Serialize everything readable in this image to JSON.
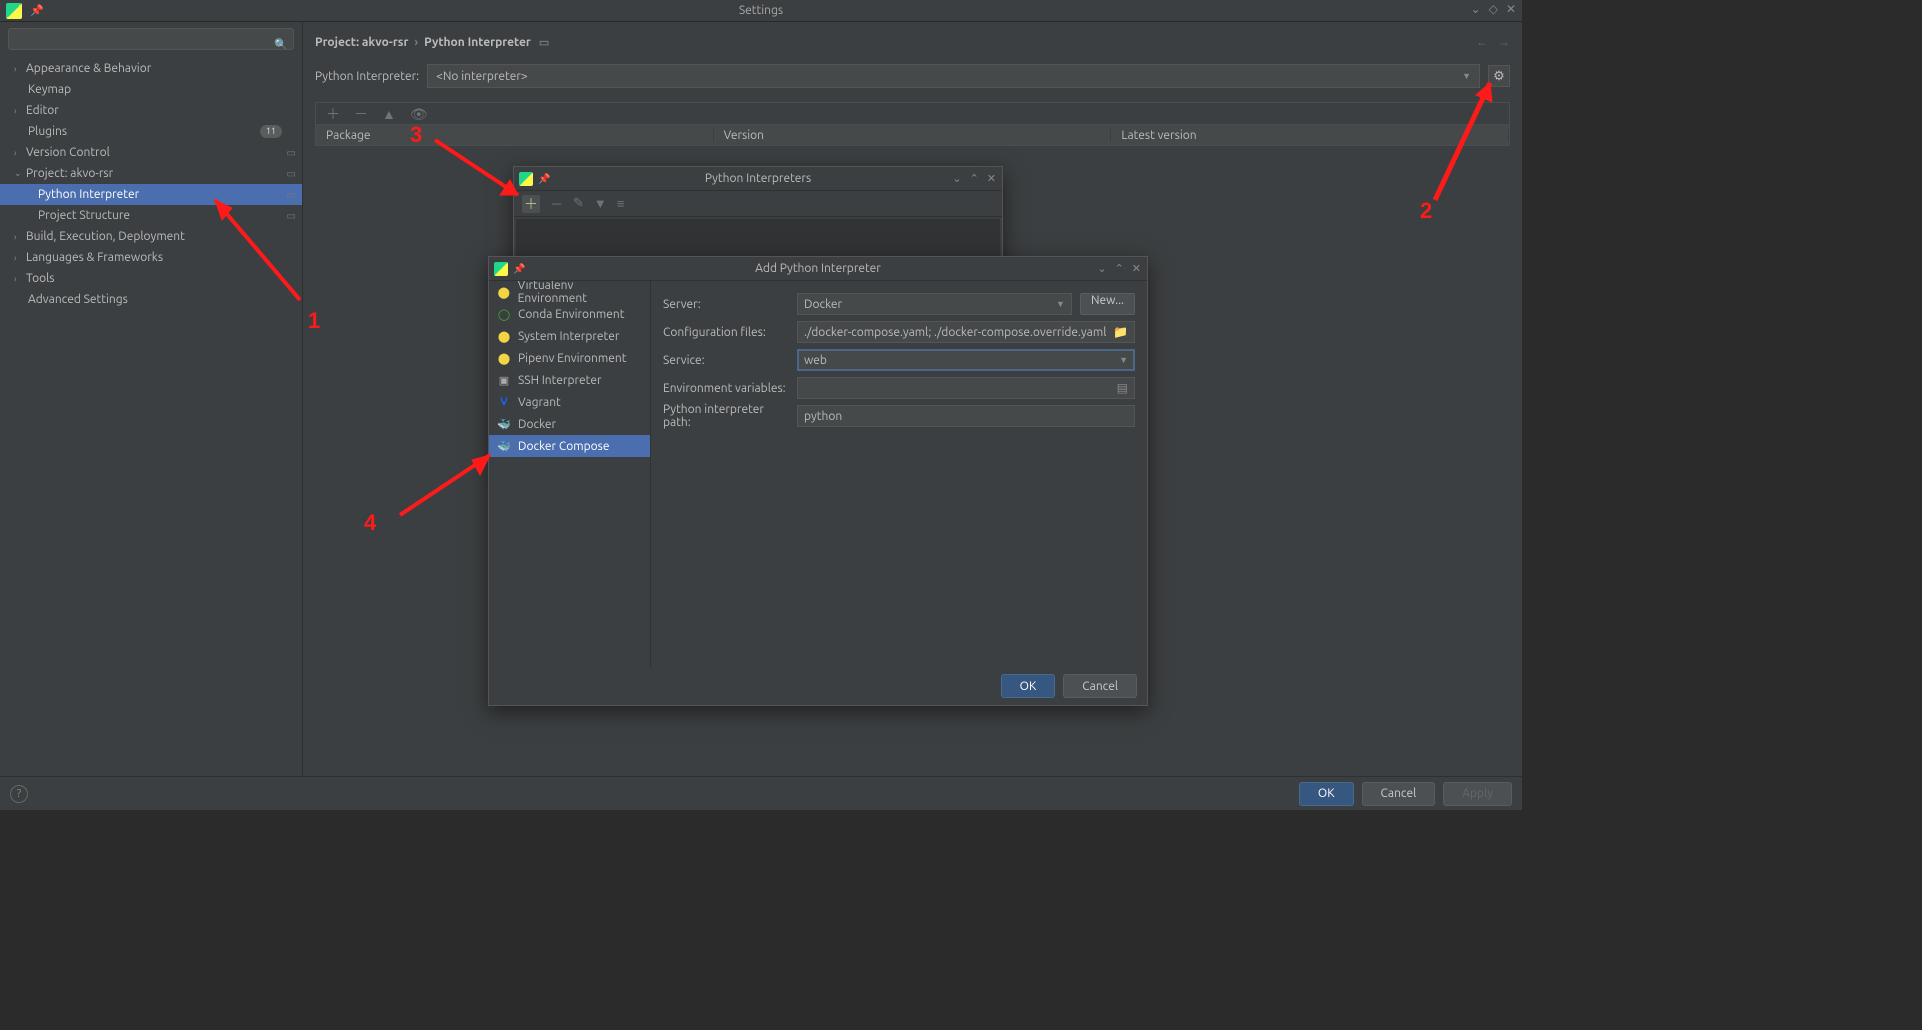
{
  "window": {
    "title": "Settings"
  },
  "sidebar": {
    "search_placeholder": "",
    "items": [
      {
        "label": "Appearance & Behavior",
        "expandable": true
      },
      {
        "label": "Keymap"
      },
      {
        "label": "Editor",
        "expandable": true
      },
      {
        "label": "Plugins",
        "badge": "11"
      },
      {
        "label": "Version Control",
        "expandable": true,
        "perproj": true
      },
      {
        "label": "Project: akvo-rsr",
        "expandable": true,
        "expanded": true,
        "perproj": true,
        "children": [
          {
            "label": "Python Interpreter",
            "perproj": true,
            "selected": true
          },
          {
            "label": "Project Structure",
            "perproj": true
          }
        ]
      },
      {
        "label": "Build, Execution, Deployment",
        "expandable": true
      },
      {
        "label": "Languages & Frameworks",
        "expandable": true
      },
      {
        "label": "Tools",
        "expandable": true
      },
      {
        "label": "Advanced Settings"
      }
    ]
  },
  "crumbs": {
    "a": "Project: akvo-rsr",
    "b": "Python Interpreter"
  },
  "interpreter_row": {
    "label": "Python Interpreter:",
    "value": "<No interpreter>"
  },
  "pkg_columns": {
    "a": "Package",
    "b": "Version",
    "c": "Latest version"
  },
  "dlg1": {
    "title": "Python Interpreters"
  },
  "dlg2": {
    "title": "Add Python Interpreter",
    "types": [
      "Virtualenv Environment",
      "Conda Environment",
      "System Interpreter",
      "Pipenv Environment",
      "SSH Interpreter",
      "Vagrant",
      "Docker",
      "Docker Compose"
    ],
    "fields": {
      "server_label": "Server:",
      "server_value": "Docker",
      "new_label": "New...",
      "config_label": "Configuration files:",
      "config_value": "./docker-compose.yaml; ./docker-compose.override.yaml",
      "service_label": "Service:",
      "service_value": "web",
      "env_label": "Environment variables:",
      "env_value": "",
      "path_label": "Python interpreter path:",
      "path_value": "python"
    },
    "ok": "OK",
    "cancel": "Cancel"
  },
  "footer": {
    "ok": "OK",
    "cancel": "Cancel",
    "apply": "Apply"
  },
  "annotations": {
    "n1": "1",
    "n2": "2",
    "n3": "3",
    "n4": "4"
  }
}
